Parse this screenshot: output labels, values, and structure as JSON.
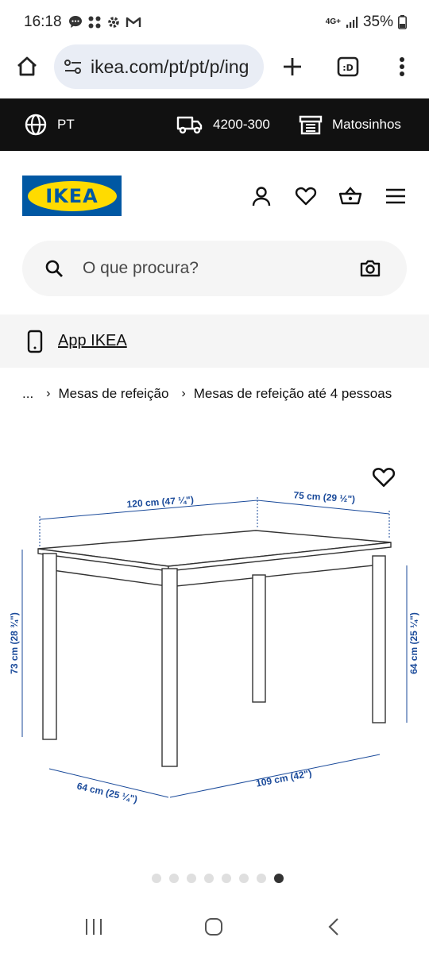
{
  "status_bar": {
    "time": "16:18",
    "signal_label": "4G+",
    "battery": "35%"
  },
  "browser": {
    "url": "ikea.com/pt/pt/p/ing"
  },
  "topstrip": {
    "language": "PT",
    "postal_code": "4200-300",
    "store": "Matosinhos"
  },
  "header": {
    "logo_text": "IKEA"
  },
  "search": {
    "placeholder": "O que procura?"
  },
  "app_banner": {
    "label": "App IKEA"
  },
  "breadcrumb": {
    "items": [
      "...",
      "Mesas de refeição",
      "Mesas de refeição até 4 pessoas"
    ]
  },
  "product_image": {
    "dimensions": {
      "length": "120 cm (47 ¼\")",
      "depth": "75 cm (29 ½\")",
      "height": "73 cm (28 ¾\")",
      "inner_height": "64 cm (25 ¼\")",
      "inner_depth": "64 cm (25 ¼\")",
      "inner_length": "109 cm (42\")"
    },
    "carousel_count": 8,
    "carousel_active_index": 7
  },
  "colors": {
    "ikea_blue": "#0058a3",
    "ikea_yellow": "#ffdb00",
    "dimension_blue": "#1a4a9a"
  }
}
